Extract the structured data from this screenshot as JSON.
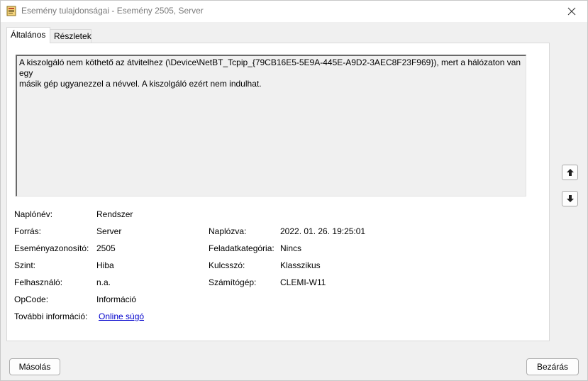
{
  "window": {
    "title": "Esemény tulajdonságai - Esemény 2505, Server"
  },
  "tabs": [
    {
      "label": "Általános",
      "active": true
    },
    {
      "label": "Részletek",
      "active": false
    }
  ],
  "message": {
    "line1": "A kiszolgáló nem köthető az átvitelhez (\\Device\\NetBT_Tcpip_{79CB16E5-5E9A-445E-A9D2-3AEC8F23F969}), mert a hálózaton van egy",
    "line2": "másik gép ugyanezzel a névvel. A kiszolgáló ezért nem indulhat."
  },
  "fields": {
    "log_name": {
      "label": "Naplónév:",
      "value": "Rendszer"
    },
    "source": {
      "label": "Forrás:",
      "value": "Server"
    },
    "logged": {
      "label": "Naplózva:",
      "value": "2022. 01. 26. 19:25:01"
    },
    "event_id": {
      "label": "Eseményazonosító:",
      "value": "2505"
    },
    "task_category": {
      "label": "Feladatkategória:",
      "value": "Nincs"
    },
    "level": {
      "label": "Szint:",
      "value": "Hiba"
    },
    "keywords": {
      "label": "Kulcsszó:",
      "value": "Klasszikus"
    },
    "user": {
      "label": "Felhasználó:",
      "value": "n.a."
    },
    "computer": {
      "label": "Számítógép:",
      "value": "CLEMI-W11"
    },
    "opcode": {
      "label": "OpCode:",
      "value": "Információ"
    },
    "more_info": {
      "label": "További információ:",
      "value": "Online súgó"
    }
  },
  "buttons": {
    "copy": "Másolás",
    "close": "Bezárás"
  },
  "icons": {
    "app": "event-viewer-icon",
    "close": "close-icon",
    "up": "arrow-up-icon",
    "down": "arrow-down-icon"
  },
  "colors": {
    "link": "#0000cc",
    "background": "#f0f0f0",
    "panel": "#ffffff"
  }
}
